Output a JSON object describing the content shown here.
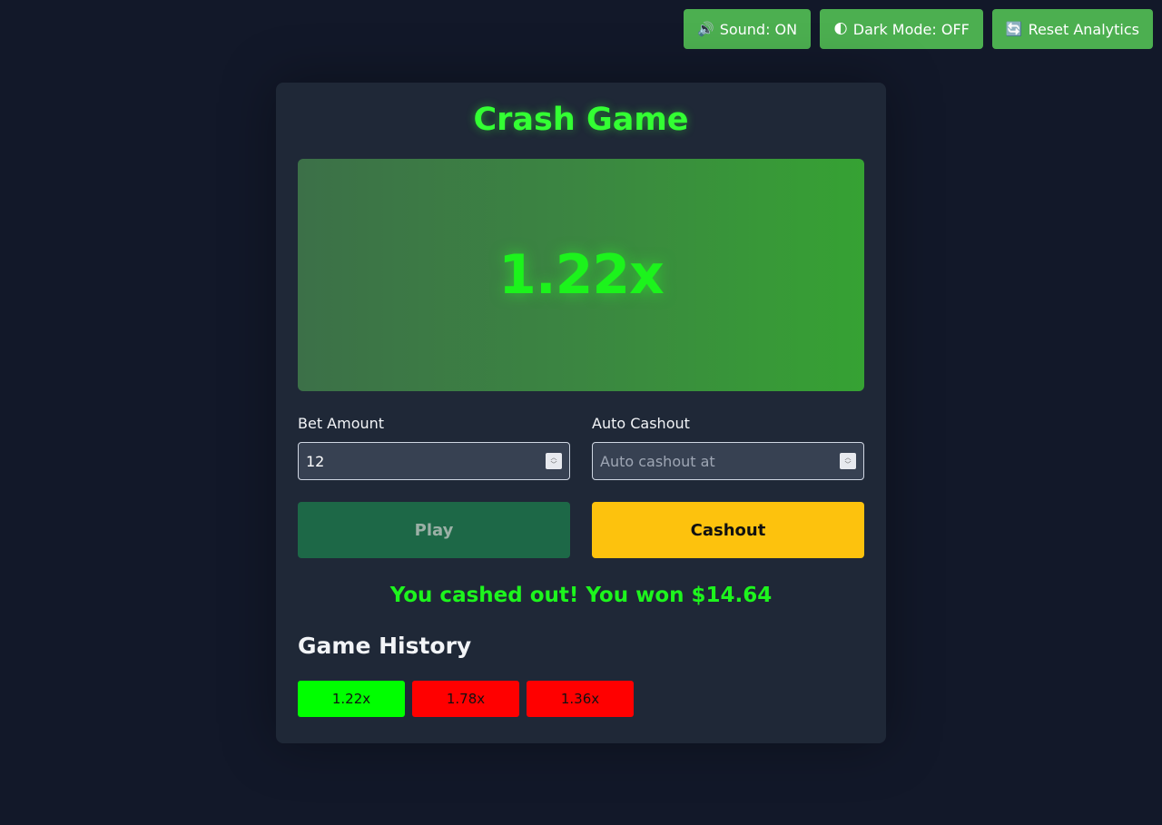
{
  "topbar": {
    "sound": {
      "icon": "speaker-icon",
      "glyph": "🔊",
      "label": "Sound: ON"
    },
    "dark_mode": {
      "icon": "half-moon-icon",
      "glyph": "🌓",
      "label": "Dark Mode: OFF"
    },
    "reset": {
      "icon": "refresh-icon",
      "glyph": "🔄",
      "label": "Reset Analytics"
    }
  },
  "game": {
    "title": "Crash Game",
    "multiplier": "1.22x"
  },
  "form": {
    "bet_label": "Bet Amount",
    "bet_value": "12",
    "auto_label": "Auto Cashout",
    "auto_value": "",
    "auto_placeholder": "Auto cashout at"
  },
  "actions": {
    "play_label": "Play",
    "cashout_label": "Cashout"
  },
  "message": "You cashed out! You won $14.64",
  "history": {
    "title": "Game History",
    "items": [
      {
        "value": "1.22x",
        "color": "#00ff00"
      },
      {
        "value": "1.78x",
        "color": "#ff0000"
      },
      {
        "value": "1.36x",
        "color": "#ff0000"
      }
    ]
  },
  "colors": {
    "accent": "#4caf50",
    "title": "#33ff33",
    "cashout": "#fdc20d",
    "play": "#1d6847"
  }
}
